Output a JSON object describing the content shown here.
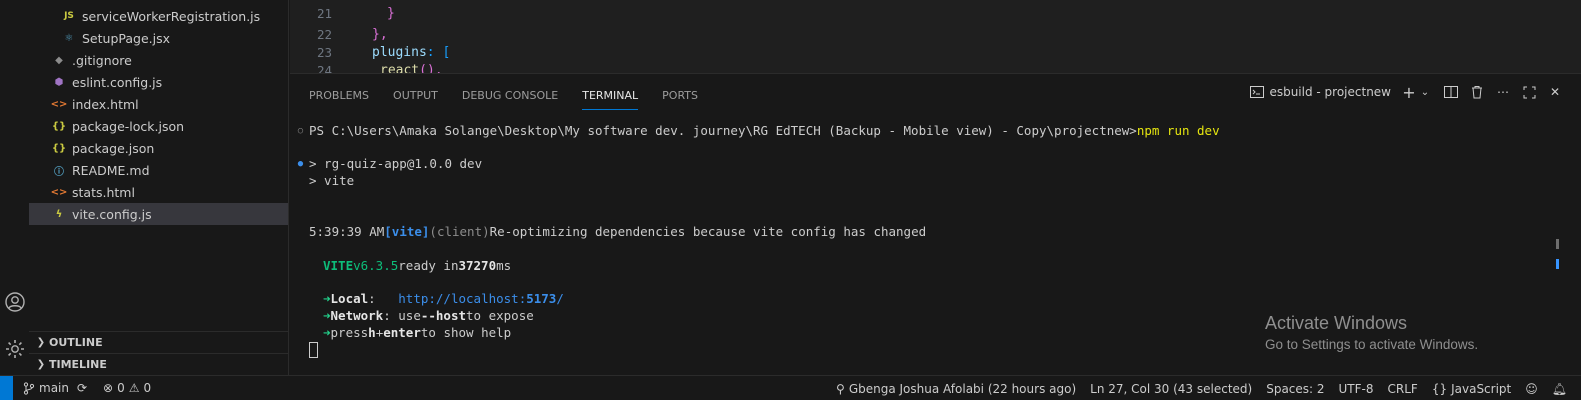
{
  "explorer": {
    "files": [
      {
        "name": "serviceWorkerRegistration.js",
        "icon": "js-file-icon",
        "badge": "JS",
        "indent": 2
      },
      {
        "name": "SetupPage.jsx",
        "icon": "react-file-icon",
        "indent": 2
      },
      {
        "name": ".gitignore",
        "icon": "git-file-icon",
        "indent": 1
      },
      {
        "name": "eslint.config.js",
        "icon": "eslint-file-icon",
        "indent": 1
      },
      {
        "name": "index.html",
        "icon": "html-file-icon",
        "indent": 1
      },
      {
        "name": "package-lock.json",
        "icon": "json-file-icon",
        "indent": 1
      },
      {
        "name": "package.json",
        "icon": "json-file-icon",
        "indent": 1
      },
      {
        "name": "README.md",
        "icon": "info-file-icon",
        "indent": 1
      },
      {
        "name": "stats.html",
        "icon": "html-file-icon",
        "indent": 1
      },
      {
        "name": "vite.config.js",
        "icon": "vite-file-icon",
        "indent": 1,
        "selected": true
      }
    ],
    "outline_label": "OUTLINE",
    "timeline_label": "TIMELINE"
  },
  "editor": {
    "lines": [
      {
        "number": "21",
        "text": "}"
      },
      {
        "number": "22",
        "text": "},"
      },
      {
        "number": "23",
        "key": "plugins",
        "text": ": ["
      },
      {
        "number": "24",
        "fn": "react",
        "text": "(),"
      }
    ]
  },
  "panel": {
    "tabs": [
      "PROBLEMS",
      "OUTPUT",
      "DEBUG CONSOLE",
      "TERMINAL",
      "PORTS"
    ],
    "active_tab": "TERMINAL",
    "terminal_name": "esbuild - projectnew"
  },
  "terminal": {
    "prompt": "PS C:\\Users\\Amaka Solange\\Desktop\\My software dev. journey\\RG EdTECH (Backup - Mobile view) - Copy\\projectnew>",
    "command": "npm run dev",
    "pkg_line": "> rg-quiz-app@1.0.0 dev",
    "vite_line": "> vite",
    "time": "5:39:39 AM",
    "vite_tag": "[vite]",
    "client_tag": "(client)",
    "reopt_msg": "Re-optimizing dependencies because vite config has changed",
    "vite_name": "VITE",
    "vite_version": "v6.3.5",
    "ready_prefix": "ready in",
    "ready_ms": "37270",
    "ready_unit": "ms",
    "arrow": "➜",
    "local_label": "Local",
    "local_url_prefix": "http://localhost:",
    "local_port": "5173",
    "local_url_suffix": "/",
    "network_label": "Network",
    "network_mid": "use",
    "network_flag": "--host",
    "network_tail": "to expose",
    "help_prefix": "press",
    "help_key_h": "h",
    "help_plus": "+",
    "help_key_enter": "enter",
    "help_tail": "to show help"
  },
  "watermark": {
    "title": "Activate Windows",
    "subtitle": "Go to Settings to activate Windows."
  },
  "statusbar": {
    "branch": "main",
    "errors": "0",
    "warnings": "0",
    "blame": "Gbenga Joshua Afolabi (22 hours ago)",
    "cursor": "Ln 27, Col 30 (43 selected)",
    "spaces": "Spaces: 2",
    "encoding": "UTF-8",
    "eol": "CRLF",
    "language": "JavaScript"
  },
  "colors": {
    "accent": "#0078d4",
    "prompt_command": "#e5e510",
    "vite_green": "#23d18b",
    "link_blue": "#3b8eea"
  }
}
